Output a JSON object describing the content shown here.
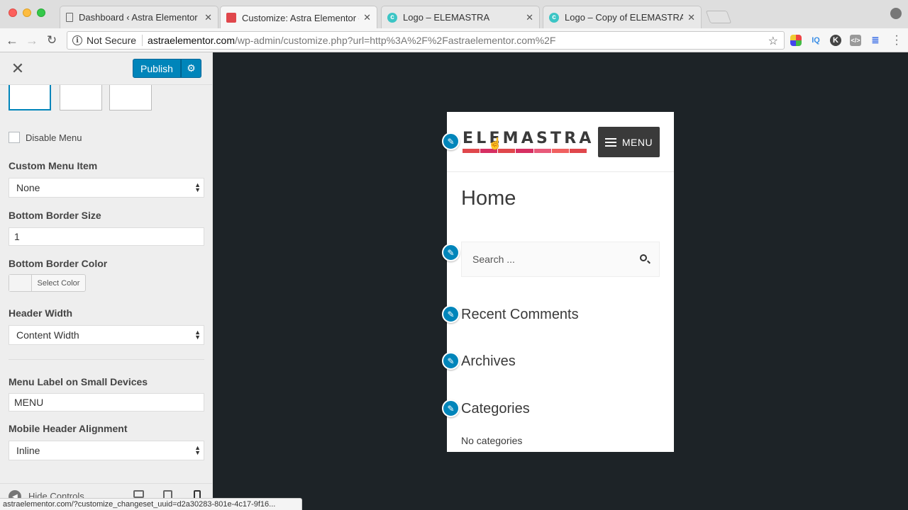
{
  "browser": {
    "tabs": [
      {
        "title": "Dashboard ‹ Astra Elementor — W",
        "favicon": "document-icon",
        "close": "✕"
      },
      {
        "title": "Customize: Astra Elementor — W",
        "favicon": "red-square-icon",
        "close": "✕"
      },
      {
        "title": "Logo – ELEMASTRA",
        "favicon": "teal-c-icon",
        "close": "✕"
      },
      {
        "title": "Logo – Copy of ELEMASTRA",
        "favicon": "teal-c-icon",
        "close": "✕"
      }
    ],
    "security_label": "Not Secure",
    "url_host": "astraelementor.com",
    "url_path": "/wp-admin/customize.php?url=http%3A%2F%2Fastraelementor.com%2F",
    "status_url": "astraelementor.com/?customize_changeset_uuid=d2a30283-801e-4c17-9f16..."
  },
  "sidebar": {
    "publish_label": "Publish",
    "disable_menu_label": "Disable Menu",
    "custom_menu_item": {
      "label": "Custom Menu Item",
      "value": "None"
    },
    "bottom_border_size": {
      "label": "Bottom Border Size",
      "value": "1"
    },
    "bottom_border_color": {
      "label": "Bottom Border Color",
      "button": "Select Color"
    },
    "header_width": {
      "label": "Header Width",
      "value": "Content Width"
    },
    "menu_label_small": {
      "label": "Menu Label on Small Devices",
      "value": "MENU"
    },
    "mobile_header_alignment": {
      "label": "Mobile Header Alignment",
      "value": "Inline"
    },
    "hide_controls_label": "Hide Controls"
  },
  "preview": {
    "logo_text": "ELEMASTRA",
    "menu_label": "MENU",
    "page_title": "Home",
    "search_placeholder": "Search ...",
    "widgets": [
      "Recent Comments",
      "Archives",
      "Categories"
    ],
    "categories_text": "No categories"
  },
  "colors": {
    "publish_blue": "#0085ba",
    "preview_bg": "#1d2327",
    "logo_bars": [
      "#e0474c",
      "#d62f62",
      "#e85a7a",
      "#f06060"
    ]
  }
}
